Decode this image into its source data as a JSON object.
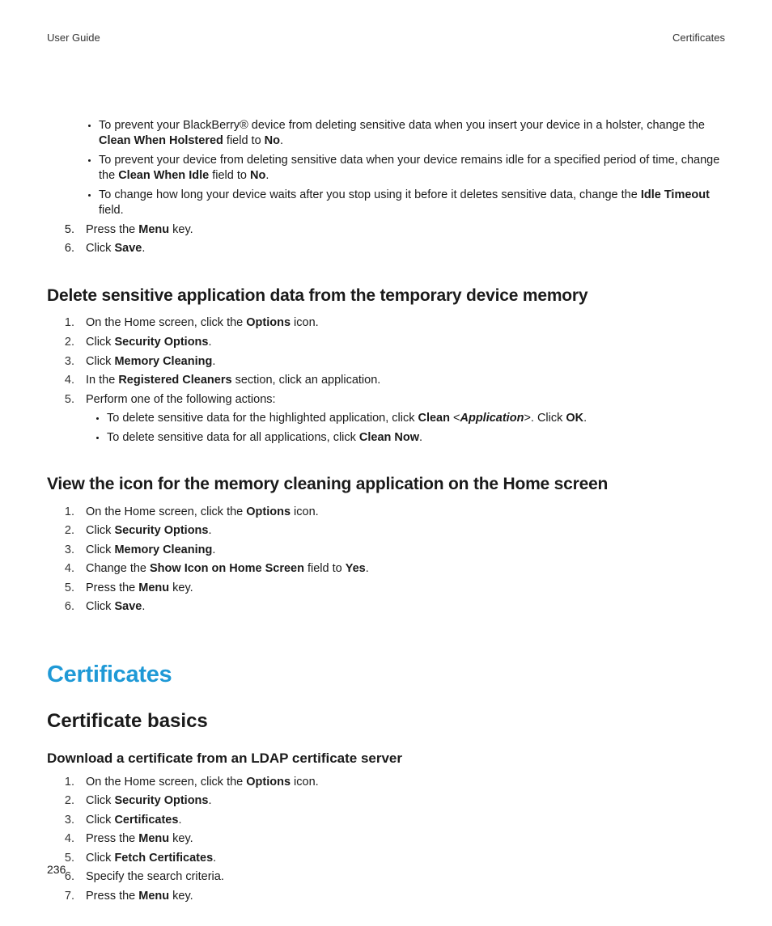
{
  "header": {
    "left": "User Guide",
    "right": "Certificates"
  },
  "initialBullets": [
    {
      "pre": "To prevent your BlackBerry® device from deleting sensitive data when you insert your device in a holster, change the ",
      "bold1": "Clean When Holstered",
      "mid": " field to ",
      "bold2": "No",
      "post": "."
    },
    {
      "pre": "To prevent your device from deleting sensitive data when your device remains idle for a specified period of time, change the ",
      "bold1": "Clean When Idle",
      "mid": " field to ",
      "bold2": "No",
      "post": "."
    },
    {
      "pre": "To change how long your device waits after you stop using it before it deletes sensitive data, change the ",
      "bold1": "Idle Timeout",
      "mid": " field.",
      "bold2": "",
      "post": ""
    }
  ],
  "continueSteps": [
    {
      "pre": "Press the ",
      "bold": "Menu",
      "post": " key."
    },
    {
      "pre": "Click ",
      "bold": "Save",
      "post": "."
    }
  ],
  "sec1": {
    "title": "Delete sensitive application data from the temporary device memory",
    "steps": [
      {
        "pre": "On the Home screen, click the ",
        "bold": "Options",
        "post": " icon."
      },
      {
        "pre": "Click ",
        "bold": "Security Options",
        "post": "."
      },
      {
        "pre": "Click ",
        "bold": "Memory Cleaning",
        "post": "."
      },
      {
        "pre": "In the ",
        "bold": "Registered Cleaners",
        "post": " section, click an application."
      },
      {
        "pre": "Perform one of the following actions:",
        "bold": "",
        "post": ""
      }
    ],
    "subBullets": [
      {
        "pre": "To delete sensitive data for the highlighted application, click ",
        "bold1": "Clean",
        "mid1": " <",
        "ital": "Application",
        "mid2": ">. Click ",
        "bold2": "OK",
        "post": "."
      },
      {
        "pre": "To delete sensitive data for all applications, click ",
        "bold1": "Clean Now",
        "mid1": ".",
        "ital": "",
        "mid2": "",
        "bold2": "",
        "post": ""
      }
    ]
  },
  "sec2": {
    "title": "View the icon for the memory cleaning application on the Home screen",
    "steps": [
      {
        "pre": "On the Home screen, click the ",
        "bold": "Options",
        "post": " icon."
      },
      {
        "pre": "Click ",
        "bold": "Security Options",
        "post": "."
      },
      {
        "pre": "Click ",
        "bold": "Memory Cleaning",
        "post": "."
      },
      {
        "pre": "Change the ",
        "bold": "Show Icon on Home Screen",
        "post": " field to ",
        "bold2": "Yes",
        "post2": "."
      },
      {
        "pre": "Press the ",
        "bold": "Menu",
        "post": " key."
      },
      {
        "pre": "Click ",
        "bold": "Save",
        "post": "."
      }
    ]
  },
  "chapterTitle": "Certificates",
  "subChapterTitle": "Certificate basics",
  "sec3": {
    "title": "Download a certificate from an LDAP certificate server",
    "steps": [
      {
        "pre": "On the Home screen, click the ",
        "bold": "Options",
        "post": " icon."
      },
      {
        "pre": "Click ",
        "bold": "Security Options",
        "post": "."
      },
      {
        "pre": "Click ",
        "bold": "Certificates",
        "post": "."
      },
      {
        "pre": "Press the ",
        "bold": "Menu",
        "post": " key."
      },
      {
        "pre": "Click ",
        "bold": "Fetch Certificates",
        "post": "."
      },
      {
        "pre": "Specify the search criteria.",
        "bold": "",
        "post": ""
      },
      {
        "pre": "Press the ",
        "bold": "Menu",
        "post": " key."
      }
    ]
  },
  "pageNumber": "236"
}
